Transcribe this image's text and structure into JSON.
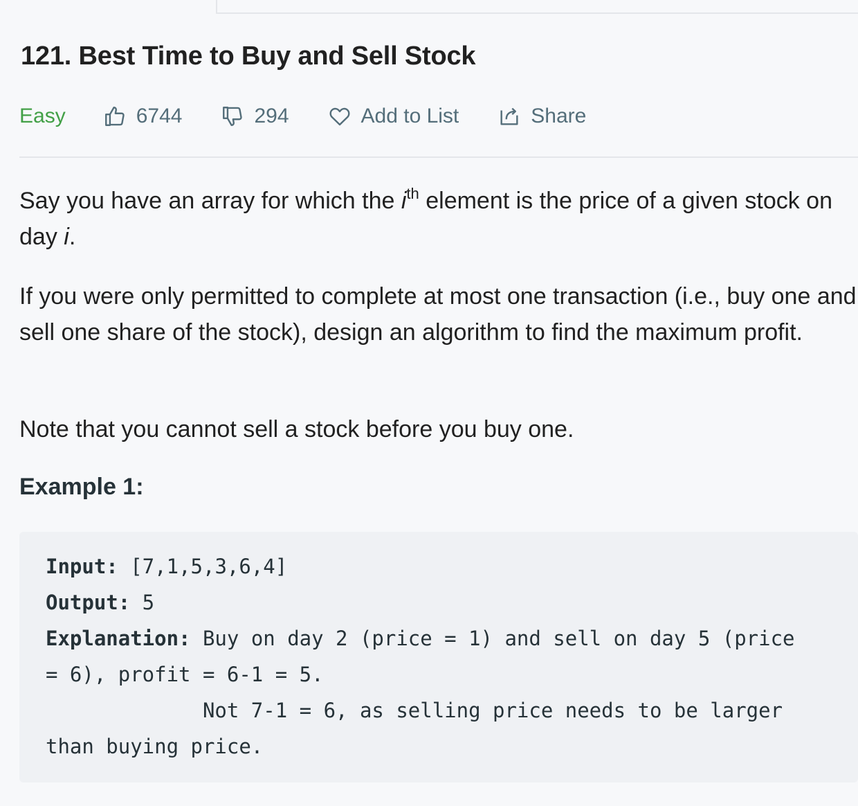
{
  "problem": {
    "number": "121.",
    "title": "Best Time to Buy and Sell Stock"
  },
  "meta": {
    "difficulty": "Easy",
    "likes": "6744",
    "dislikes": "294",
    "add_to_list": "Add to List",
    "share": "Share",
    "colors": {
      "easy": "#43a047",
      "icon": "#546e7a"
    },
    "icons": [
      "thumbs-up-icon",
      "thumbs-down-icon",
      "heart-icon",
      "share-icon"
    ]
  },
  "description": {
    "p1_a": "Say you have an array for which the ",
    "p1_i": "i",
    "p1_sup": "th",
    "p1_b": " element is the price of a given stock on day ",
    "p1_day": "i",
    "p1_end": ".",
    "p2": "If you were only permitted to complete at most one transaction (i.e., buy one and sell one share of the stock), design an algorithm to find the maximum profit.",
    "p3": "Note that you cannot sell a stock before you buy one."
  },
  "example": {
    "title": "Example 1:",
    "input_label": "Input:",
    "input_value": " [7,1,5,3,6,4]",
    "output_label": "Output:",
    "output_value": " 5",
    "explanation_label": "Explanation:",
    "explanation_line1": " Buy on day 2 (price = 1) and sell on day 5 (price",
    "explanation_line2": "= 6), profit = 6-1 = 5.",
    "explanation_line3": "             Not 7-1 = 6, as selling price needs to be larger",
    "explanation_line4": "than buying price."
  }
}
